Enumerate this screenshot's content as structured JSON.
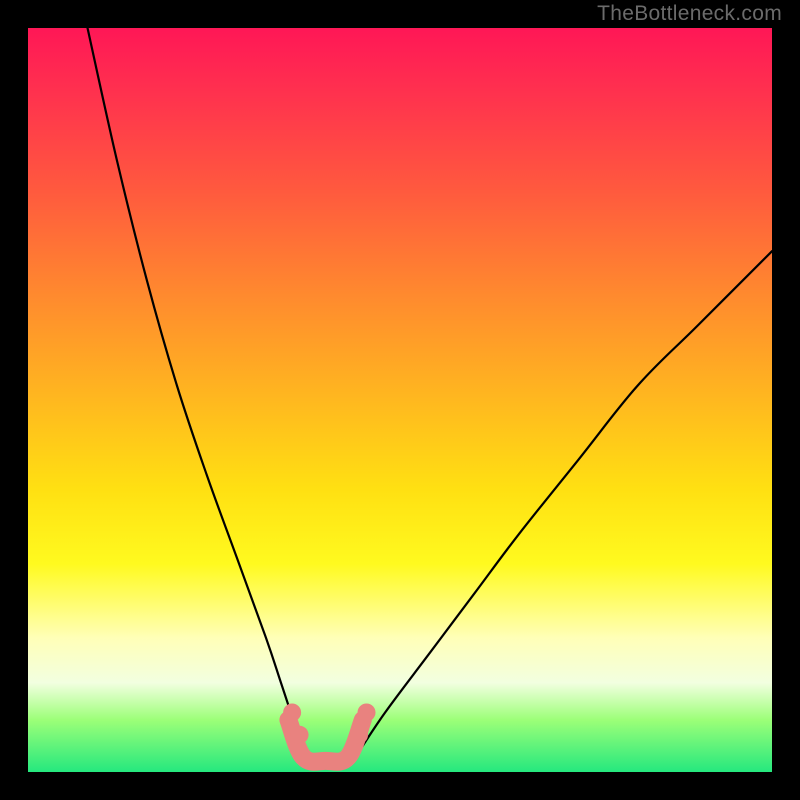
{
  "watermark": "TheBottleneck.com",
  "chart_data": {
    "type": "line",
    "title": "",
    "xlabel": "",
    "ylabel": "",
    "xlim": [
      0,
      100
    ],
    "ylim": [
      0,
      100
    ],
    "grid": false,
    "legend": false,
    "note": "Background color encodes bottleneck severity: red=high at top, green=low at bottom. Two black curves descend into a small pink flat region near the bottom (the optimal/balanced zone).",
    "series": [
      {
        "name": "left-curve",
        "color": "#000000",
        "x": [
          8,
          12,
          16,
          20,
          24,
          28,
          32,
          34,
          36,
          37.5
        ],
        "y": [
          100,
          82,
          66,
          52,
          40,
          29,
          18,
          12,
          6,
          2
        ]
      },
      {
        "name": "right-curve",
        "color": "#000000",
        "x": [
          44,
          48,
          54,
          60,
          66,
          74,
          82,
          90,
          100
        ],
        "y": [
          2,
          8,
          16,
          24,
          32,
          42,
          52,
          60,
          70
        ]
      },
      {
        "name": "optimal-band",
        "color": "#e9827f",
        "x": [
          35,
          37,
          40,
          43,
          45
        ],
        "y": [
          7,
          2,
          1.5,
          2,
          7
        ]
      }
    ]
  }
}
